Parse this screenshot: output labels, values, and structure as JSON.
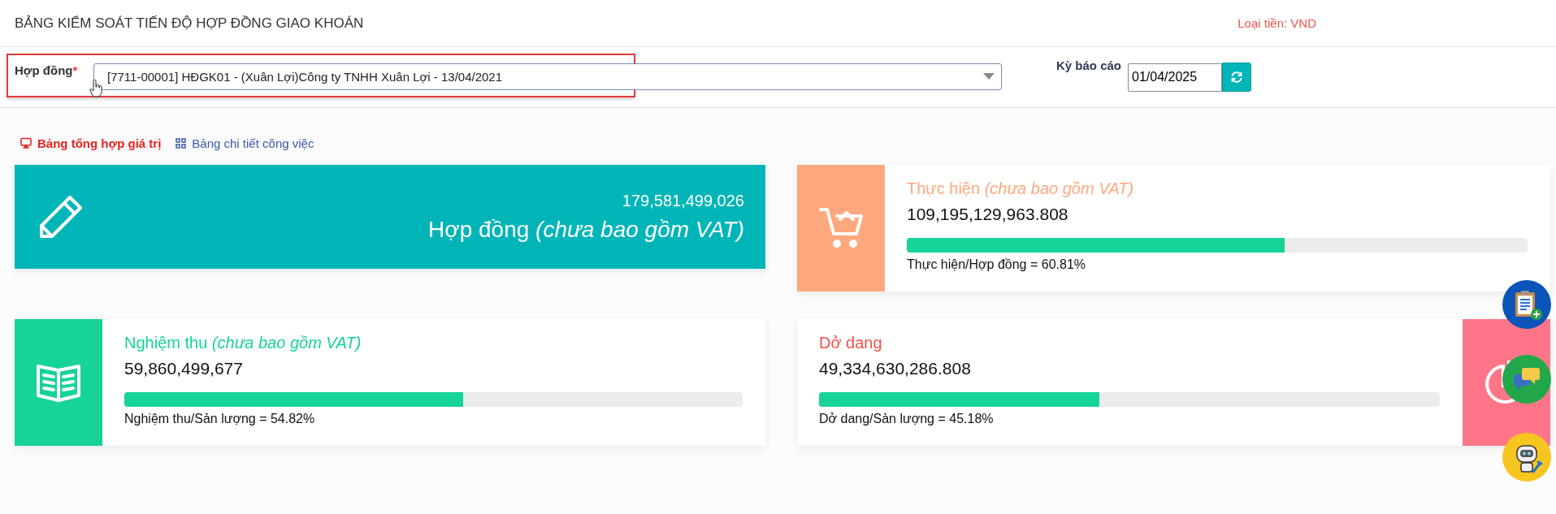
{
  "header": {
    "title": "BẢNG KIỂM SOÁT TIẾN ĐỘ HỢP ĐỒNG GIAO KHOÁN",
    "currency": "Loại tiền: VND"
  },
  "filters": {
    "contract_label": "Hợp đồng",
    "required_mark": "*",
    "contract_value": "[7711-00001] HĐGK01 - (Xuân Lợi)Công ty TNHH Xuân Lợi - 13/04/2021",
    "period_label": "Kỳ báo cáo",
    "period_value": "01/04/2025"
  },
  "tabs": [
    {
      "label": "Bảng tổng hợp giá trị",
      "selected": true
    },
    {
      "label": "Bảng chi tiết công việc",
      "selected": false
    }
  ],
  "summary": {
    "value": "179,581,499,026",
    "label": "Hợp đồng *(chưa bao gồm VAT)*",
    "color": "#00b5b8"
  },
  "cards": [
    {
      "kind": "left",
      "title": "Thực hiện *(chưa bao gồm VAT)*",
      "value": "109,195,129,963.808",
      "level": 0.6081,
      "caption": "Thực hiện/Hợp đồng = 60.81%",
      "color": "#ffa87d"
    },
    {
      "kind": "left",
      "title": "Nghiệm thu *(chưa bao gồm VAT)*",
      "value": "59,860,499,677",
      "level": 0.5482,
      "caption": "Nghiệm thu/Sản lượng = 54.82%",
      "color": "#16d39a"
    },
    {
      "kind": "right",
      "title": "Dở dang",
      "value": "49,334,630,286.808",
      "level": 0.4518,
      "caption": "Dở dang/Sản lượng = 45.18%",
      "color": "#ff7588"
    }
  ]
}
